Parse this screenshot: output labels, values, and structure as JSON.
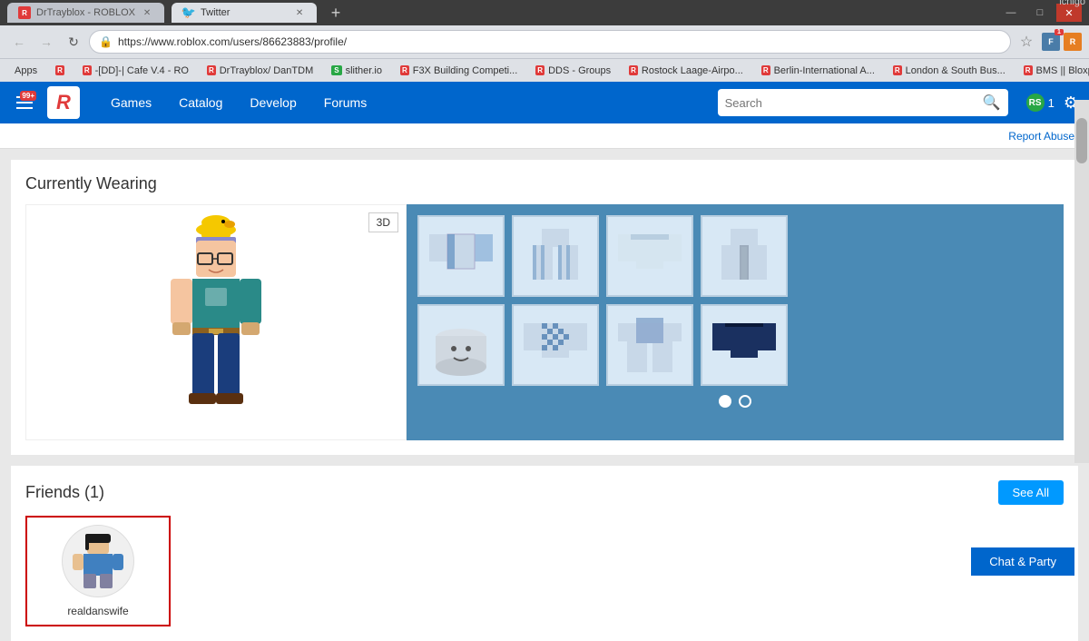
{
  "browser": {
    "profile": "ichigo",
    "tabs": [
      {
        "id": "roblox-tab",
        "label": "DrTrayblox - ROBLOX",
        "active": false,
        "favicon": "R"
      },
      {
        "id": "twitter-tab",
        "label": "Twitter",
        "active": true,
        "favicon": "🐦"
      }
    ],
    "address": "https://www.roblox.com/users/86623883/profile/",
    "window_controls": [
      "—",
      "□",
      "✕"
    ]
  },
  "bookmarks": [
    {
      "id": "apps",
      "label": "Apps",
      "icon": null
    },
    {
      "id": "roblox1",
      "label": "R",
      "icon": "R"
    },
    {
      "id": "cafe",
      "label": "-[DD]-| Cafe V.4 - RO",
      "icon": "R"
    },
    {
      "id": "drtrayblox",
      "label": "DrTrayblox/ DanTDM",
      "icon": "R"
    },
    {
      "id": "slither",
      "label": "slither.io",
      "icon": "S"
    },
    {
      "id": "f3x",
      "label": "F3X Building Competi...",
      "icon": "R"
    },
    {
      "id": "dds",
      "label": "DDS - Groups",
      "icon": "R"
    },
    {
      "id": "rostock",
      "label": "Rostock Laage-Airpo...",
      "icon": "R"
    },
    {
      "id": "berlin",
      "label": "Berlin-International A...",
      "icon": "R"
    },
    {
      "id": "london",
      "label": "London & South Bus...",
      "icon": "R"
    },
    {
      "id": "bms",
      "label": "BMS || Bloxport Midd...",
      "icon": "R"
    }
  ],
  "header": {
    "notification_count": "99+",
    "nav_items": [
      "Games",
      "Catalog",
      "Develop",
      "Forums"
    ],
    "search_placeholder": "Search",
    "robux_count": "1",
    "settings_label": "Settings"
  },
  "page": {
    "report_abuse": "Report Abuse",
    "currently_wearing_title": "Currently Wearing",
    "btn_3d": "3D",
    "items": [
      {
        "id": 1,
        "color": "#c8d8e8",
        "accent": "#6090c0",
        "type": "shirt"
      },
      {
        "id": 2,
        "color": "#c8d8e8",
        "accent": "#6090c0",
        "type": "pants"
      },
      {
        "id": 3,
        "color": "#c8d8e8",
        "accent": "#6090c0",
        "type": "shirt"
      },
      {
        "id": 4,
        "color": "#c8d8e8",
        "accent": "#8090a0",
        "type": "pants"
      },
      {
        "id": 5,
        "color": "#d8e0e8",
        "accent": "#a0a8b0",
        "type": "head"
      },
      {
        "id": 6,
        "color": "#c8d8e8",
        "accent": "#5080b0",
        "type": "shirt"
      },
      {
        "id": 7,
        "color": "#c8d8e8",
        "accent": "#2050a0",
        "type": "pants"
      },
      {
        "id": 8,
        "color": "#1a3060",
        "accent": "#102040",
        "type": "shirt"
      }
    ],
    "pagination_dots": [
      "active",
      "inactive"
    ],
    "friends_title": "Friends (1)",
    "see_all_label": "See All",
    "friends": [
      {
        "username": "realdanswife",
        "avatar_color": "#d0e8f5"
      }
    ],
    "chat_party_label": "Chat & Party"
  }
}
